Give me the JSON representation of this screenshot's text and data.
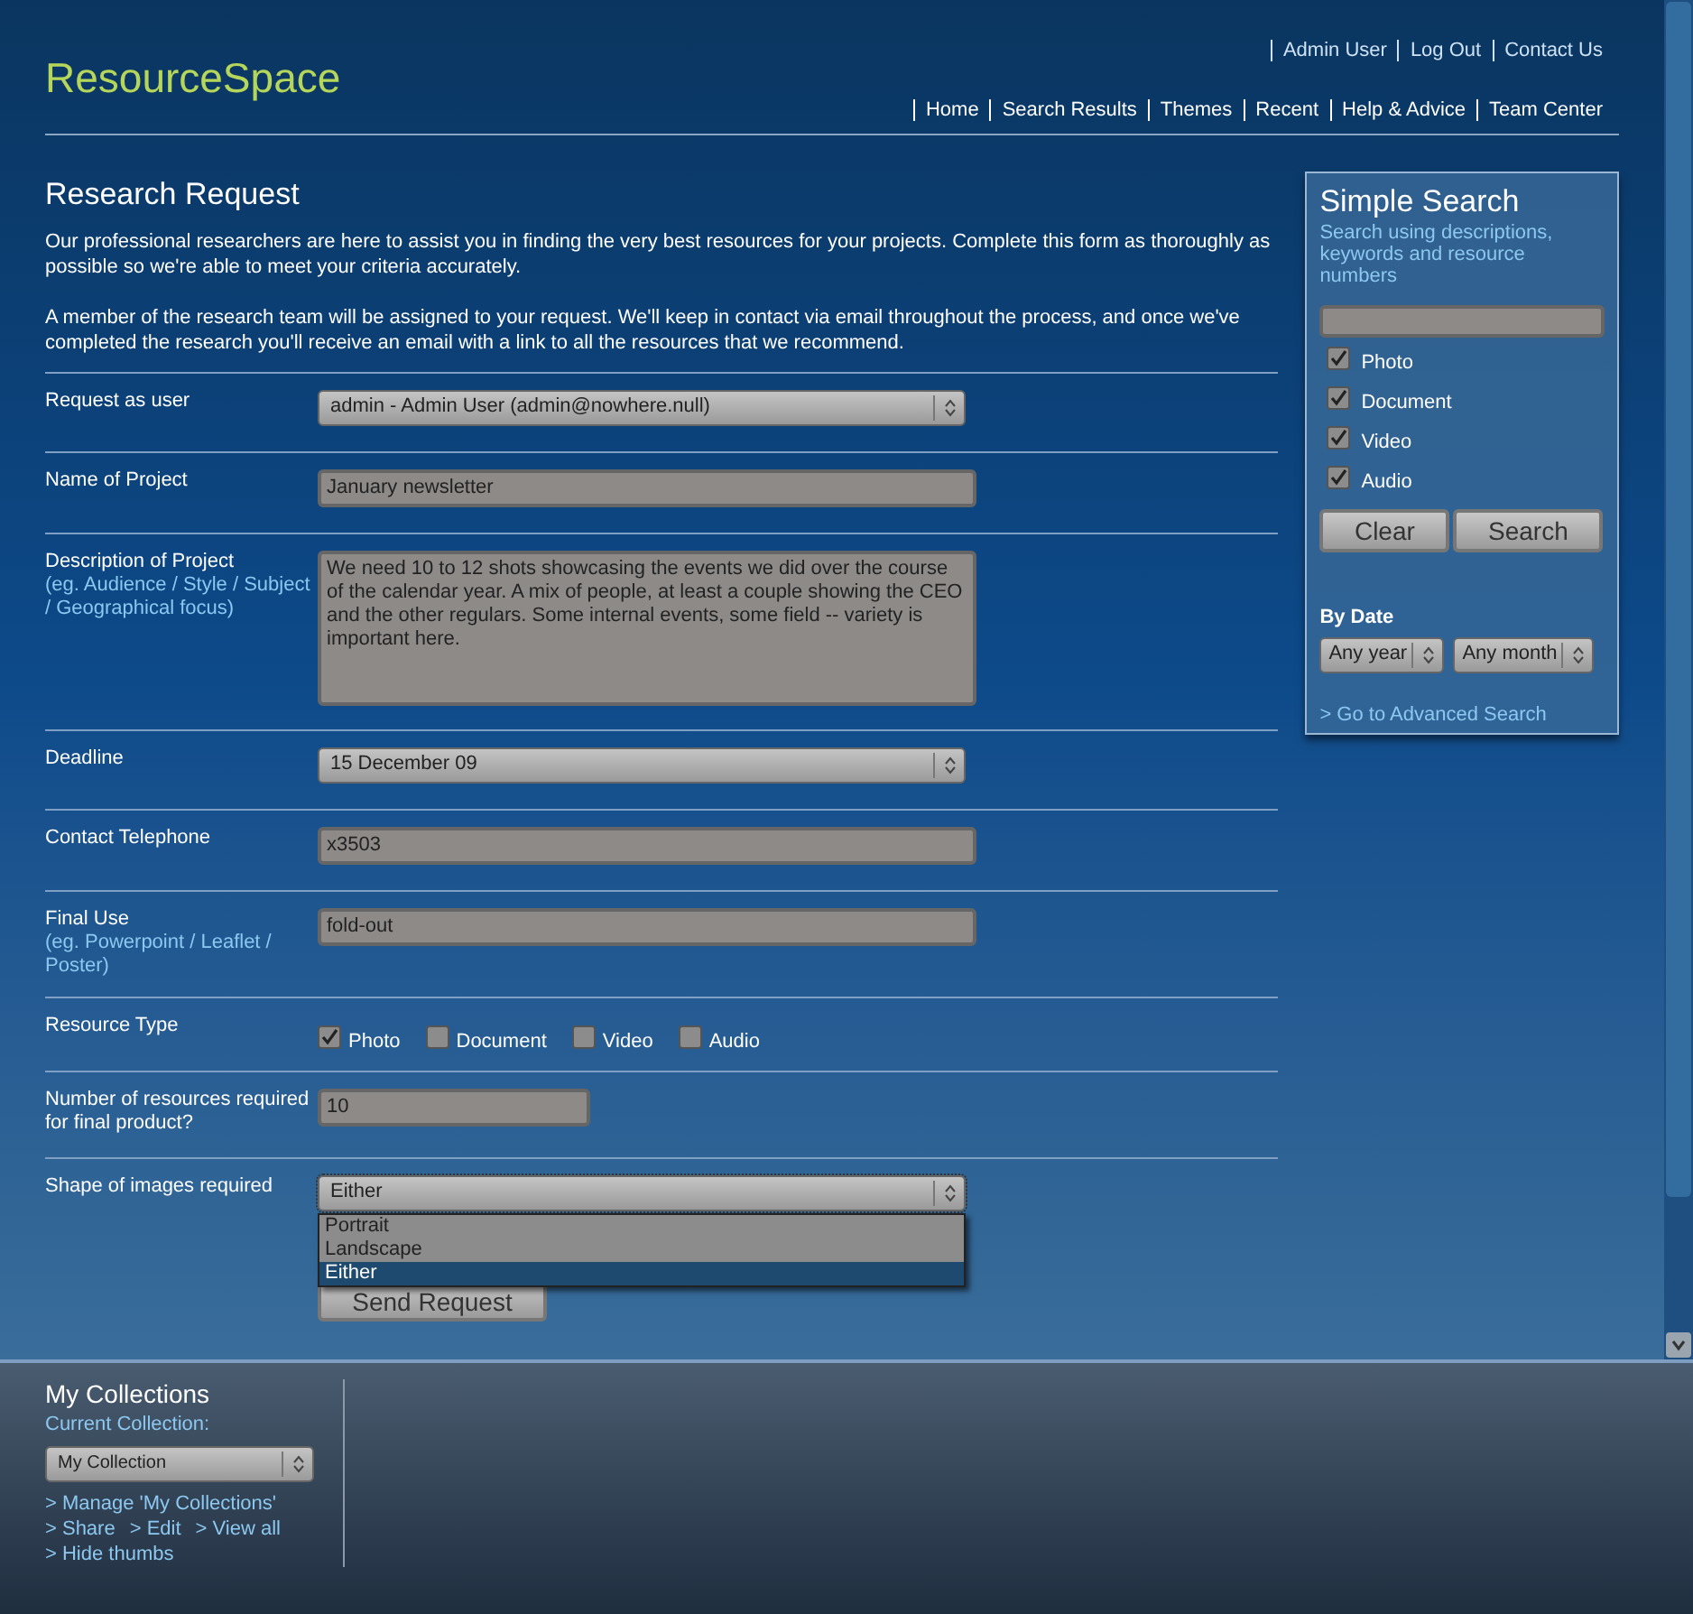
{
  "header": {
    "logo": "ResourceSpace",
    "top_links": [
      "Admin User",
      "Log Out",
      "Contact Us"
    ],
    "nav": [
      "Home",
      "Search Results",
      "Themes",
      "Recent",
      "Help & Advice",
      "Team Center"
    ]
  },
  "page": {
    "title": "Research Request",
    "intro": [
      "Our professional researchers are here to assist you in finding the very best resources for your projects. Complete this form as thoroughly as possible so we're able to meet your criteria accurately.",
      "A member of the research team will be assigned to your request. We'll keep in contact via email throughout the process, and once we've completed the research you'll receive an email with a link to all the resources that we recommend."
    ]
  },
  "form": {
    "rows": [
      {
        "kind": "select",
        "label": "Request as user",
        "value": "admin - Admin User (admin@nowhere.null)"
      },
      {
        "kind": "text",
        "label": "Name of Project",
        "value": "January newsletter"
      },
      {
        "kind": "textarea",
        "label": "Description of Project",
        "hint": "(eg. Audience / Style / Subject / Geographical focus)",
        "value": "We need 10 to 12 shots showcasing the events we did over the course of the calendar year.  A mix of people, at least a couple showing the CEO and the other regulars.  Some internal events, some field -- variety is important here."
      },
      {
        "kind": "select",
        "label": "Deadline",
        "value": "15 December 09"
      },
      {
        "kind": "text",
        "label": "Contact Telephone",
        "value": "x3503"
      },
      {
        "kind": "text",
        "label": "Final Use",
        "hint": "(eg. Powerpoint / Leaflet / Poster)",
        "value": "fold-out"
      },
      {
        "kind": "checkboxes",
        "label": "Resource Type",
        "options": [
          {
            "label": "Photo",
            "checked": true
          },
          {
            "label": "Document",
            "checked": false
          },
          {
            "label": "Video",
            "checked": false
          },
          {
            "label": "Audio",
            "checked": false
          }
        ]
      },
      {
        "kind": "short_text",
        "label": "Number of resources required for final product?",
        "value": "10"
      },
      {
        "kind": "open_select",
        "label": "Shape of images required",
        "value": "Either",
        "options": [
          {
            "label": "Portrait",
            "selected": false
          },
          {
            "label": "Landscape",
            "selected": false
          },
          {
            "label": "Either",
            "selected": true
          }
        ]
      }
    ],
    "submit": "Send Request"
  },
  "sidebar": {
    "title": "Simple Search",
    "hint": "Search using descriptions, keywords and resource numbers",
    "types": [
      {
        "label": "Photo",
        "checked": true
      },
      {
        "label": "Document",
        "checked": true
      },
      {
        "label": "Video",
        "checked": true
      },
      {
        "label": "Audio",
        "checked": true
      }
    ],
    "buttons": [
      "Clear",
      "Search"
    ],
    "by_date": "By Date",
    "year": "Any year",
    "month": "Any month",
    "advanced_link": "> Go to Advanced Search"
  },
  "collections": {
    "title": "My Collections",
    "current_label": "Current Collection:",
    "current": "My Collection",
    "links": [
      [
        "> Manage 'My Collections'"
      ],
      [
        "> Share",
        "> Edit",
        "> View all"
      ],
      [
        "> Hide thumbs"
      ]
    ]
  }
}
